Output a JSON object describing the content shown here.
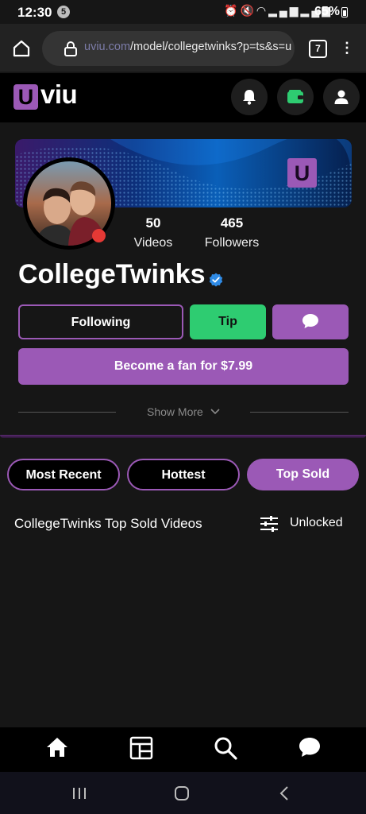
{
  "status_bar": {
    "time": "12:30",
    "notification_count": "5",
    "icons": [
      "alarm-icon",
      "mute-icon",
      "wifi-icon",
      "signal-icon",
      "signal-icon"
    ],
    "battery": "65%"
  },
  "browser": {
    "url_domain": "uviu.com",
    "url_path": "/model/collegetwinks?p=ts&s=u",
    "tab_count": "7"
  },
  "site": {
    "logo_letter": "U",
    "logo_text": "viu",
    "cover_logo_letter": "U"
  },
  "profile": {
    "name": "CollegeTwinks",
    "stats": [
      {
        "value": "50",
        "label": "Videos"
      },
      {
        "value": "465",
        "label": "Followers"
      }
    ],
    "online": true
  },
  "actions": {
    "following": "Following",
    "tip": "Tip",
    "become_fan": "Become a fan for $7.99",
    "show_more": "Show More"
  },
  "tabs": [
    {
      "label": "Most Recent",
      "active": false
    },
    {
      "label": "Hottest",
      "active": false
    },
    {
      "label": "Top Sold",
      "active": true
    }
  ],
  "section": {
    "title": "CollegeTwinks Top Sold Videos",
    "filter_label": "Unlocked"
  },
  "colors": {
    "accent": "#9b59b6",
    "tip_green": "#2ecc71",
    "background": "#161616",
    "online_red": "#e53935"
  }
}
